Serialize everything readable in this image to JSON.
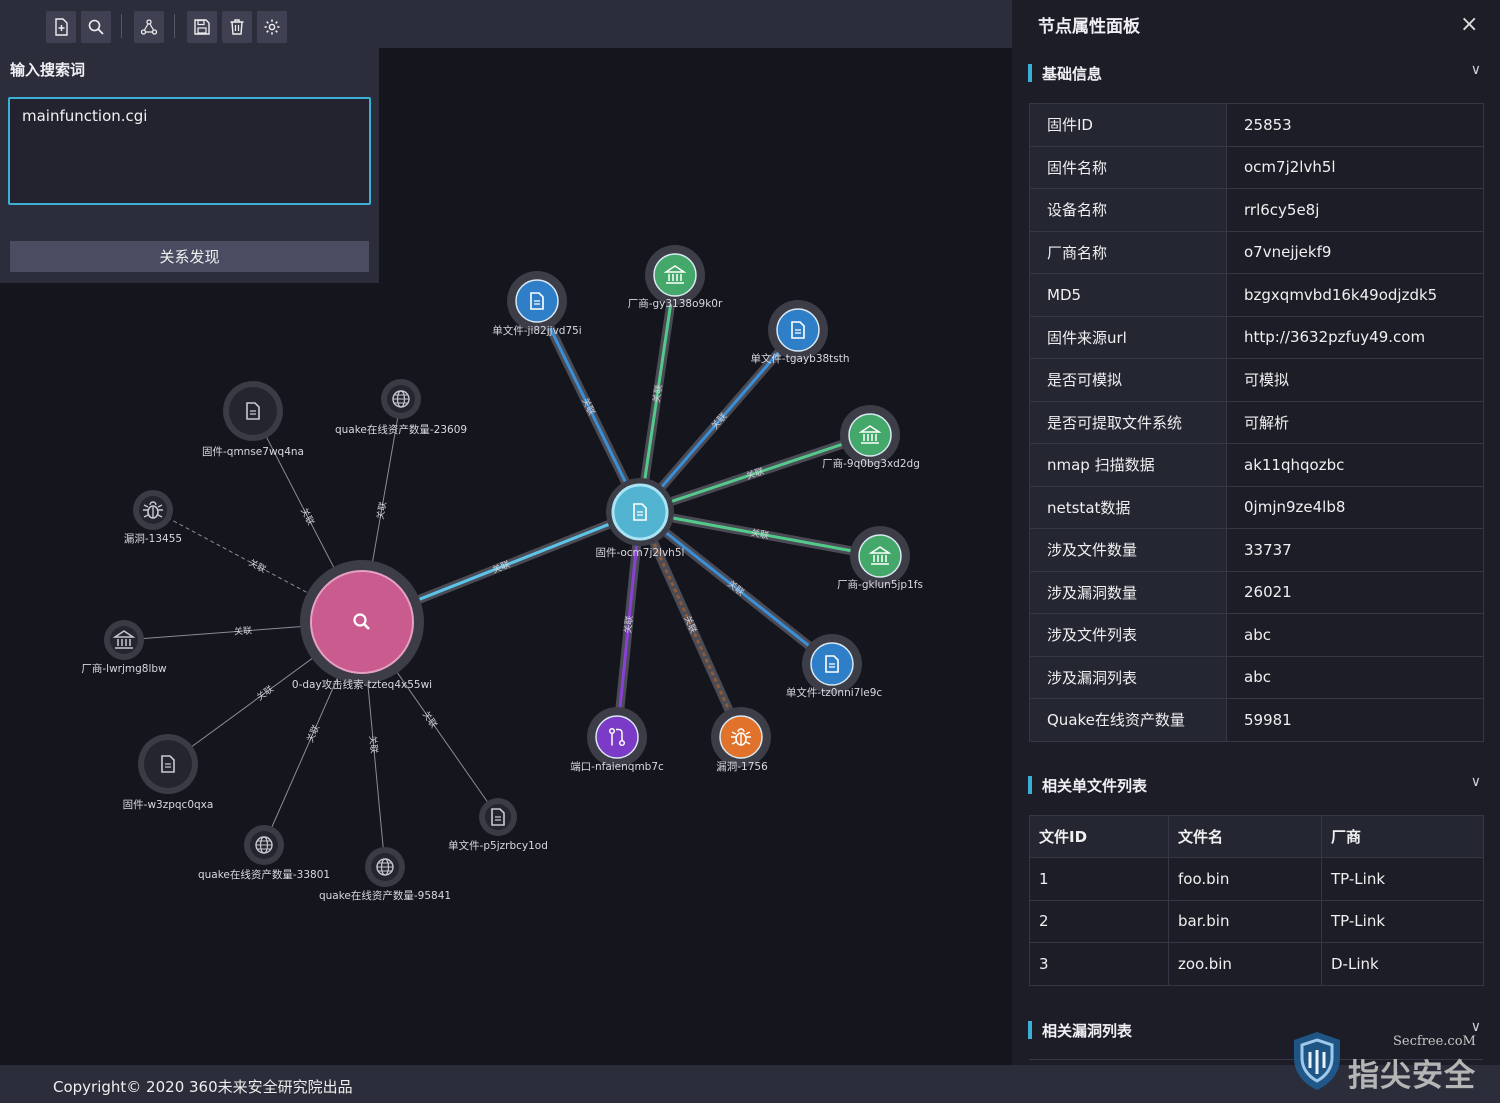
{
  "toolbar": {
    "buttons": [
      "add-file-icon",
      "search-icon",
      "graph-icon",
      "save-icon",
      "delete-icon",
      "settings-icon"
    ]
  },
  "search": {
    "title": "输入搜索词",
    "value": "mainfunction.cgi",
    "button_label": "关系发现"
  },
  "graph": {
    "edge_label": "关联",
    "nodes": {
      "center": "固件-ocm7j2lvh5l",
      "search": "0-day攻击线索-tzteq4x55wi",
      "n1": "单文件-ji82jjvd75i",
      "n2": "厂商-gy3138o9k0r",
      "n3": "单文件-tgayb38tsth",
      "n4": "厂商-9q0bg3xd2dg",
      "n5": "厂商-gklun5jp1fs",
      "n6": "单文件-tz0nni7le9c",
      "n7": "漏洞-1756",
      "n8": "端口-nfaienqmb7c",
      "s1": "固件-qmnse7wq4na",
      "s2": "quake在线资产数量-23609",
      "s3": "漏洞-13455",
      "s4": "厂商-lwrjmg8lbw",
      "s5": "固件-w3zpqc0qxa",
      "s6": "quake在线资产数量-33801",
      "s7": "quake在线资产数量-95841",
      "s8": "单文件-p5jzrbcy1od"
    }
  },
  "footer": {
    "text": "Copyright© 2020 360未来安全研究院出品"
  },
  "panel": {
    "title": "节点属性面板",
    "close": "×",
    "section_basic": "基础信息",
    "section_files": "相关单文件列表",
    "section_vulns": "相关漏洞列表",
    "chevron": "∨",
    "info": [
      {
        "k": "固件ID",
        "v": "25853"
      },
      {
        "k": "固件名称",
        "v": "ocm7j2lvh5l"
      },
      {
        "k": "设备名称",
        "v": "rrl6cy5e8j"
      },
      {
        "k": "厂商名称",
        "v": "o7vnejjekf9"
      },
      {
        "k": "MD5",
        "v": "bzgxqmvbd16k49odjzdk5"
      },
      {
        "k": "固件来源url",
        "v": "http://3632pzfuy49.com"
      },
      {
        "k": "是否可模拟",
        "v": "可模拟"
      },
      {
        "k": "是否可提取文件系统",
        "v": "可解析"
      },
      {
        "k": "nmap 扫描数据",
        "v": "ak11qhqozbc"
      },
      {
        "k": "netstat数据",
        "v": "0jmjn9ze4lb8"
      },
      {
        "k": "涉及文件数量",
        "v": "33737"
      },
      {
        "k": "涉及漏洞数量",
        "v": "26021"
      },
      {
        "k": "涉及文件列表",
        "v": "abc"
      },
      {
        "k": "涉及漏洞列表",
        "v": "abc"
      },
      {
        "k": "Quake在线资产数量",
        "v": "59981"
      }
    ],
    "files_header": [
      "文件ID",
      "文件名",
      "厂商"
    ],
    "files": [
      [
        "1",
        "foo.bin",
        "TP-Link"
      ],
      [
        "2",
        "bar.bin",
        "TP-Link"
      ],
      [
        "3",
        "zoo.bin",
        "D-Link"
      ]
    ]
  },
  "watermark": {
    "site": "Secfree.coM",
    "brand": "指尖安全"
  },
  "colors": {
    "accent": "#3ab0d6",
    "search_node": "#c95b8f",
    "vendor": "#43a86a",
    "file": "#2f7fc8",
    "port": "#7b3bc6",
    "vuln": "#e0722c"
  }
}
